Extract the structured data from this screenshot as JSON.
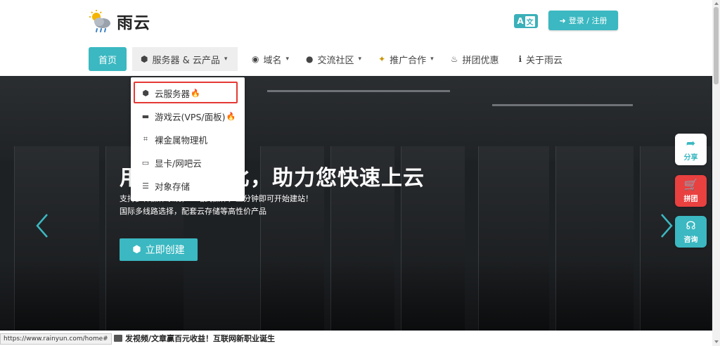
{
  "brand": {
    "name": "雨云"
  },
  "header": {
    "lang_label": "A",
    "login_label": "登录 / 注册"
  },
  "nav": {
    "items": [
      {
        "label": "首页"
      },
      {
        "label": "服务器 & 云产品"
      },
      {
        "label": "域名"
      },
      {
        "label": "交流社区"
      },
      {
        "label": "推广合作"
      },
      {
        "label": "拼团优惠"
      },
      {
        "label": "关于雨云"
      }
    ]
  },
  "dropdown": {
    "items": [
      {
        "label": "云服务器"
      },
      {
        "label": "游戏云(VPS/面板)"
      },
      {
        "label": "裸金属物理机"
      },
      {
        "label": "显卡/网吧云"
      },
      {
        "label": "对象存储"
      }
    ]
  },
  "hero": {
    "title": "用心品性价比，助力您快速上云",
    "subtitle1": "支持多种操作系统，一站式操作，三分钟即可开始建站！",
    "subtitle2": "国际多线路选择，配套云存储等高性价产品",
    "cta_label": "立即创建"
  },
  "side": {
    "share": "分享",
    "group": "拼团",
    "consult": "咨询"
  },
  "status": {
    "url": "https://www.rainyun.com/home#"
  },
  "ticker": {
    "text": "发视频/文章赢百元收益！互联网新职业诞生"
  },
  "colors": {
    "accent": "#3bb8c1",
    "red": "#e94040",
    "highlight": "#e53935",
    "fire": "#f57c00"
  }
}
